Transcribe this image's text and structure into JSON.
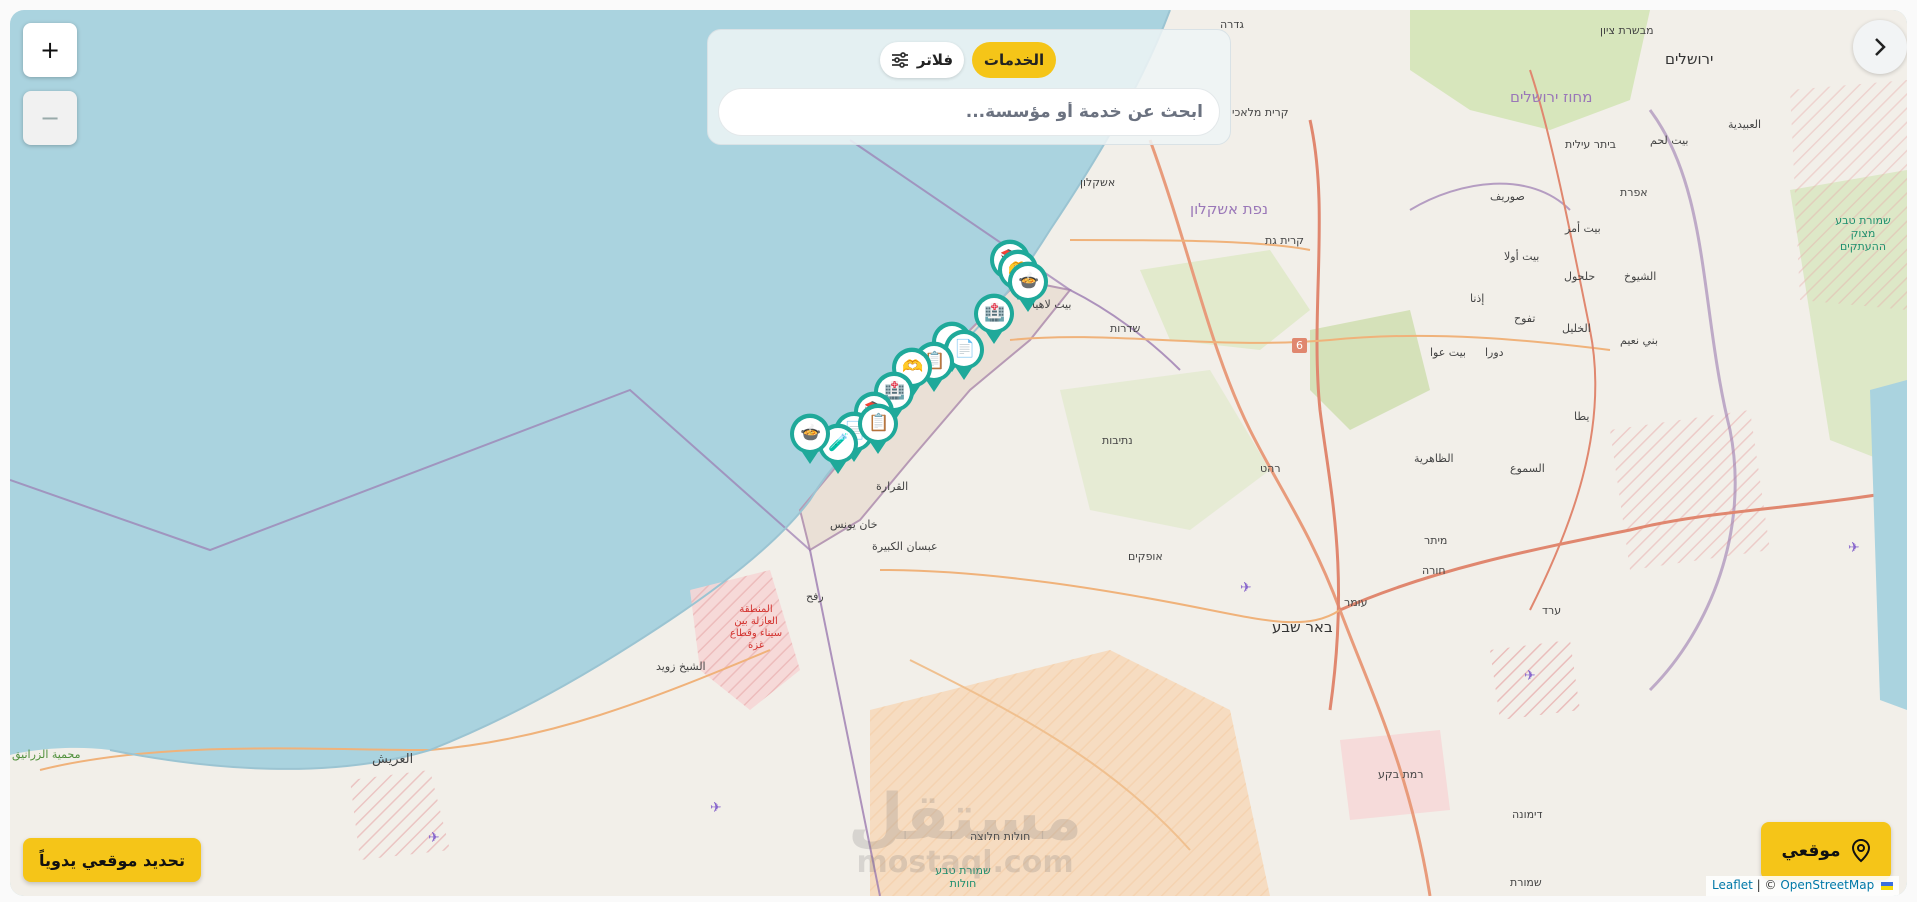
{
  "map": {
    "zoom_in_label": "+",
    "zoom_out_label": "−",
    "watermark_top": "مستقل",
    "watermark_bottom": "mostaql.com",
    "places": [
      {
        "id": "jerusalem",
        "text": "ירושלים",
        "cls": "big"
      },
      {
        "id": "jerusalem-district",
        "text": "מחוז ירושלים",
        "cls": "purple"
      },
      {
        "id": "mevaseret",
        "text": "מבשרת ציון",
        "cls": ""
      },
      {
        "id": "gedera",
        "text": "גדרה",
        "cls": ""
      },
      {
        "id": "kiryat-malakhi",
        "text": "קרית מלאכי",
        "cls": ""
      },
      {
        "id": "ashkelon",
        "text": "אשקלון",
        "cls": ""
      },
      {
        "id": "ashkelon-dist",
        "text": "נפת אשקלון",
        "cls": "purple"
      },
      {
        "id": "kiryat-gat",
        "text": "קרית גת",
        "cls": ""
      },
      {
        "id": "beitar",
        "text": "ביתר עילית",
        "cls": ""
      },
      {
        "id": "beit-lahm",
        "text": "بيت لحم",
        "cls": ""
      },
      {
        "id": "ubeidiya",
        "text": "العبيدية",
        "cls": ""
      },
      {
        "id": "efrat",
        "text": "אפרת",
        "cls": ""
      },
      {
        "id": "surif",
        "text": "صوريف",
        "cls": ""
      },
      {
        "id": "beit-ummar",
        "text": "بيت أمر",
        "cls": ""
      },
      {
        "id": "beit-ula",
        "text": "بيت أولا",
        "cls": ""
      },
      {
        "id": "halhul",
        "text": "حلحول",
        "cls": ""
      },
      {
        "id": "shuyukh",
        "text": "الشيوخ",
        "cls": ""
      },
      {
        "id": "idna",
        "text": "إذنا",
        "cls": ""
      },
      {
        "id": "taffuh",
        "text": "تفوح",
        "cls": ""
      },
      {
        "id": "hebron",
        "text": "الخليل",
        "cls": ""
      },
      {
        "id": "bani-naim",
        "text": "بني نعيم",
        "cls": ""
      },
      {
        "id": "beit-awwa",
        "text": "بيت عوا",
        "cls": ""
      },
      {
        "id": "dura",
        "text": "دورا",
        "cls": ""
      },
      {
        "id": "yatta",
        "text": "يطا",
        "cls": ""
      },
      {
        "id": "dhahiriya",
        "text": "الظاهرية",
        "cls": ""
      },
      {
        "id": "samu",
        "text": "السموع",
        "cls": ""
      },
      {
        "id": "sderot",
        "text": "שדרות",
        "cls": ""
      },
      {
        "id": "beit-lahia",
        "text": "بيت لاهيا",
        "cls": ""
      },
      {
        "id": "netivot",
        "text": "נתיבות",
        "cls": ""
      },
      {
        "id": "rahat",
        "text": "רהט",
        "cls": ""
      },
      {
        "id": "ofakim",
        "text": "אופקים",
        "cls": ""
      },
      {
        "id": "beersheba",
        "text": "באר שבע",
        "cls": "big"
      },
      {
        "id": "omer",
        "text": "עומר",
        "cls": ""
      },
      {
        "id": "meitar",
        "text": "מיתר",
        "cls": ""
      },
      {
        "id": "hura",
        "text": "חורה",
        "cls": ""
      },
      {
        "id": "arad",
        "text": "ערד",
        "cls": ""
      },
      {
        "id": "qarara",
        "text": "القرارة",
        "cls": ""
      },
      {
        "id": "khan-younis",
        "text": "خان يونس",
        "cls": ""
      },
      {
        "id": "abasan",
        "text": "عبسان الكبيرة",
        "cls": ""
      },
      {
        "id": "rafah",
        "text": "رفح",
        "cls": ""
      },
      {
        "id": "sheikh-zuweid",
        "text": "الشيخ زويد",
        "cls": ""
      },
      {
        "id": "arish",
        "text": "العريش",
        "cls": "med"
      },
      {
        "id": "zaranik",
        "text": "محمية الزرانيق",
        "cls": "green"
      },
      {
        "id": "ramat-bekaa",
        "text": "רמת בקע",
        "cls": ""
      },
      {
        "id": "dimona",
        "text": "דימונה",
        "cls": ""
      },
      {
        "id": "halutza",
        "text": "חולות חלוצה",
        "cls": ""
      },
      {
        "id": "halutza-reserve",
        "text": "שמורת טבע חולות",
        "cls": "teal"
      },
      {
        "id": "negev-reserve",
        "text": "שמורת",
        "cls": ""
      },
      {
        "id": "buffer-zone",
        "text": "المنطقة العازلة بين سيناء وقطاع غزة",
        "cls": "red"
      },
      {
        "id": "nature-reserve-east",
        "text": "שמורת טבע מצוק ההעתקים",
        "cls": "teal"
      },
      {
        "id": "road-6",
        "text": "6",
        "cls": ""
      }
    ]
  },
  "panel": {
    "services_label": "الخدمات",
    "filter_label": "فلاتر",
    "search_placeholder": "ابحث عن خدمة أو مؤسسة..."
  },
  "buttons": {
    "manual_location": "تحديد موقعي يدوياً",
    "my_location": "موقعي"
  },
  "attribution": {
    "leaflet": "Leaflet",
    "separator": " | © ",
    "osm": "OpenStreetMap"
  },
  "markers": [
    {
      "icon": "books-icon",
      "glyph": "📚"
    },
    {
      "icon": "heart-hands-icon",
      "glyph": "🫶"
    },
    {
      "icon": "donation-icon",
      "glyph": "🍲"
    },
    {
      "icon": "medical-icon",
      "glyph": "🏥"
    },
    {
      "icon": "pill-icon",
      "glyph": "🧪"
    },
    {
      "icon": "document-icon",
      "glyph": "📄"
    },
    {
      "icon": "clipboard-icon",
      "glyph": "📋"
    },
    {
      "icon": "heart-hands-icon",
      "glyph": "🫶"
    },
    {
      "icon": "medical-icon",
      "glyph": "🏥"
    },
    {
      "icon": "books-icon",
      "glyph": "📚"
    },
    {
      "icon": "document-icon",
      "glyph": "📄"
    },
    {
      "icon": "pill-icon",
      "glyph": "🧪"
    },
    {
      "icon": "clipboard-icon",
      "glyph": "📋"
    },
    {
      "icon": "donation-icon",
      "glyph": "🍲"
    }
  ],
  "colors": {
    "sea": "#aad3df",
    "land": "#f2efe9",
    "accent_yellow": "#f5c518",
    "marker_teal": "#1fa99a"
  }
}
